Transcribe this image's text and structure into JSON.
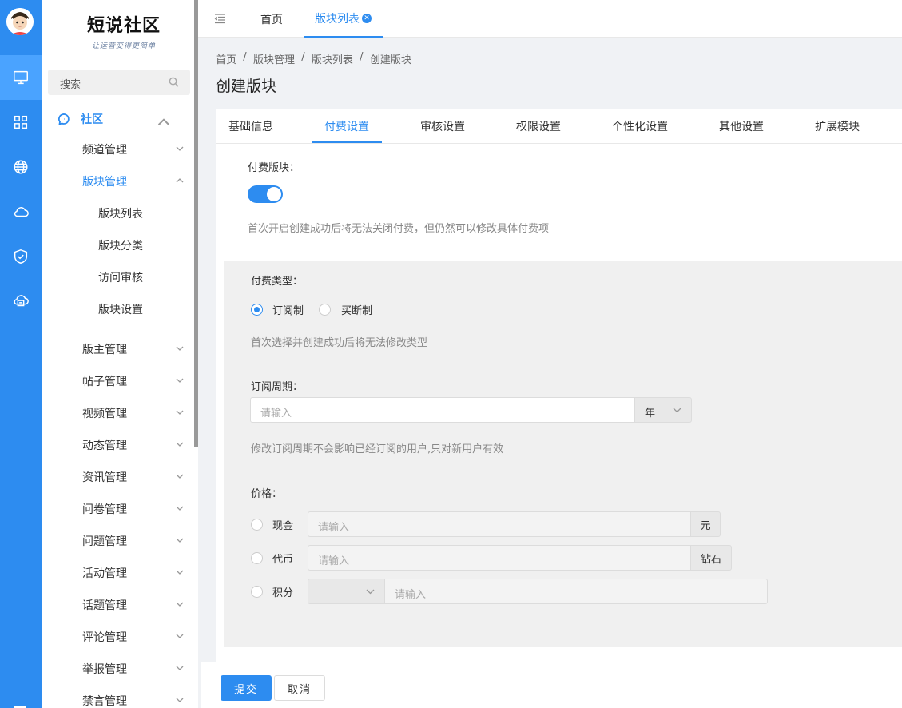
{
  "sidebar": {
    "logo_title": "短说社区",
    "logo_subtitle": "让运营变得更简单",
    "search_placeholder": "搜索",
    "group": "社区",
    "items": [
      {
        "label": "频道管理"
      },
      {
        "label": "版块管理"
      },
      {
        "label": "版主管理"
      },
      {
        "label": "帖子管理"
      },
      {
        "label": "视频管理"
      },
      {
        "label": "动态管理"
      },
      {
        "label": "资讯管理"
      },
      {
        "label": "问卷管理"
      },
      {
        "label": "问题管理"
      },
      {
        "label": "活动管理"
      },
      {
        "label": "话题管理"
      },
      {
        "label": "评论管理"
      },
      {
        "label": "举报管理"
      },
      {
        "label": "禁言管理"
      }
    ],
    "subitems": [
      {
        "label": "版块列表"
      },
      {
        "label": "版块分类"
      },
      {
        "label": "访问审核"
      },
      {
        "label": "版块设置"
      }
    ]
  },
  "topbar": {
    "tabs": [
      {
        "label": "首页"
      },
      {
        "label": "版块列表"
      }
    ]
  },
  "breadcrumb": [
    "首页",
    "版块管理",
    "版块列表",
    "创建版块"
  ],
  "breadcrumb_sep": "/",
  "page_title": "创建版块",
  "form_tabs": [
    {
      "label": "基础信息"
    },
    {
      "label": "付费设置"
    },
    {
      "label": "审核设置"
    },
    {
      "label": "权限设置"
    },
    {
      "label": "个性化设置"
    },
    {
      "label": "其他设置"
    },
    {
      "label": "扩展模块"
    }
  ],
  "paid": {
    "label": "付费版块：",
    "enabled": true,
    "hint": "首次开启创建成功后将无法关闭付费，但仍然可以修改具体付费项"
  },
  "pay_type": {
    "label": "付费类型：",
    "options": [
      "订阅制",
      "买断制"
    ],
    "selected": "订阅制",
    "hint": "首次选择并创建成功后将无法修改类型"
  },
  "period": {
    "label": "订阅周期：",
    "placeholder": "请输入",
    "unit": "年",
    "hint": "修改订阅周期不会影响已经订阅的用户,只对新用户有效"
  },
  "price": {
    "label": "价格：",
    "rows": [
      {
        "name": "现金",
        "placeholder": "请输入",
        "unit": "元"
      },
      {
        "name": "代币",
        "placeholder": "请输入",
        "unit": "钻石"
      },
      {
        "name": "积分",
        "placeholder": "请输入",
        "unit": ""
      }
    ]
  },
  "actions": {
    "submit": "提交",
    "cancel": "取消"
  },
  "colors": {
    "primary": "#2d8cf0",
    "rail": "#2d8cf0"
  }
}
